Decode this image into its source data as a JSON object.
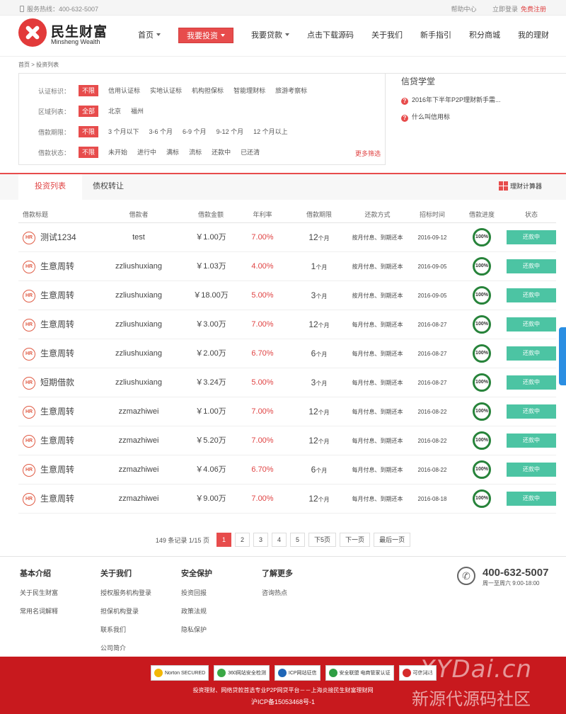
{
  "topbar": {
    "hotline": "服务热线：400-632-5007",
    "help": "帮助中心",
    "login": "立即登录",
    "register": "免费注册"
  },
  "logo": {
    "cn": "民生财富",
    "en": "Minsheng Wealth"
  },
  "nav": [
    {
      "label": "首页",
      "dropdown": true,
      "active": false
    },
    {
      "label": "我要投资",
      "dropdown": true,
      "active": true
    },
    {
      "label": "我要贷款",
      "dropdown": true,
      "active": false
    },
    {
      "label": "点击下载源码",
      "dropdown": false,
      "active": false
    },
    {
      "label": "关于我们",
      "dropdown": false,
      "active": false
    },
    {
      "label": "新手指引",
      "dropdown": false,
      "active": false
    },
    {
      "label": "积分商城",
      "dropdown": false,
      "active": false
    },
    {
      "label": "我的理财",
      "dropdown": false,
      "active": false
    }
  ],
  "breadcrumb": "首页 > 投资列表",
  "filters": [
    {
      "label": "认证标识：",
      "options": [
        "不限",
        "信用认证标",
        "实地认证标",
        "机构担保标",
        "智能理财标",
        "旅游考察标"
      ],
      "selected": 0
    },
    {
      "label": "区域列表：",
      "options": [
        "全部",
        "北京",
        "福州"
      ],
      "selected": 0
    },
    {
      "label": "借款期限：",
      "options": [
        "不限",
        "3 个月以下",
        "3-6 个月",
        "6-9 个月",
        "9-12 个月",
        "12 个月以上"
      ],
      "selected": 0
    },
    {
      "label": "借款状态：",
      "options": [
        "不限",
        "未开始",
        "进行中",
        "满标",
        "流标",
        "还款中",
        "已还清"
      ],
      "selected": 0
    }
  ],
  "more_filters": "更多筛选",
  "school": {
    "title": "信贷学堂",
    "links": [
      "2016年下半年P2P理财新手需...",
      "什么叫信用标"
    ]
  },
  "tabs": {
    "invest_list": "投资列表",
    "transfer": "债权转让",
    "calculator": "理财计算器"
  },
  "table": {
    "headers": [
      "借款标题",
      "借款者",
      "借款金额",
      "年利率",
      "借款期限",
      "还款方式",
      "招标时间",
      "借款进度",
      "状态"
    ],
    "rows": [
      {
        "badge": "HR",
        "title": "测试1234",
        "borrower": "test",
        "amount": "￥1.00万",
        "rate": "7.00%",
        "term": "12",
        "unit": "个月",
        "repay": "按月付息、到期还本",
        "date": "2016-09-12",
        "progress": "100%",
        "status": "还款中"
      },
      {
        "badge": "HR",
        "title": "生意周转",
        "borrower": "zzliushuxiang",
        "amount": "￥1.03万",
        "rate": "4.00%",
        "term": "1",
        "unit": "个月",
        "repay": "按月付息、到期还本",
        "date": "2016-09-05",
        "progress": "100%",
        "status": "还款中"
      },
      {
        "badge": "HR",
        "title": "生意周转",
        "borrower": "zzliushuxiang",
        "amount": "￥18.00万",
        "rate": "5.00%",
        "term": "3",
        "unit": "个月",
        "repay": "按月付息、到期还本",
        "date": "2016-09-05",
        "progress": "100%",
        "status": "还款中"
      },
      {
        "badge": "HR",
        "title": "生意周转",
        "borrower": "zzliushuxiang",
        "amount": "￥3.00万",
        "rate": "7.00%",
        "term": "12",
        "unit": "个月",
        "repay": "每月付息、到期还本",
        "date": "2016-08-27",
        "progress": "100%",
        "status": "还款中"
      },
      {
        "badge": "HR",
        "title": "生意周转",
        "borrower": "zzliushuxiang",
        "amount": "￥2.00万",
        "rate": "6.70%",
        "term": "6",
        "unit": "个月",
        "repay": "每月付息、到期还本",
        "date": "2016-08-27",
        "progress": "100%",
        "status": "还款中"
      },
      {
        "badge": "HR",
        "title": "短期借款",
        "borrower": "zzliushuxiang",
        "amount": "￥3.24万",
        "rate": "5.00%",
        "term": "3",
        "unit": "个月",
        "repay": "每月付息、到期还本",
        "date": "2016-08-27",
        "progress": "100%",
        "status": "还款中"
      },
      {
        "badge": "HR",
        "title": "生意周转",
        "borrower": "zzmazhiwei",
        "amount": "￥1.00万",
        "rate": "7.00%",
        "term": "12",
        "unit": "个月",
        "repay": "每月付息、到期还本",
        "date": "2016-08-22",
        "progress": "100%",
        "status": "还款中"
      },
      {
        "badge": "HR",
        "title": "生意周转",
        "borrower": "zzmazhiwei",
        "amount": "￥5.20万",
        "rate": "7.00%",
        "term": "12",
        "unit": "个月",
        "repay": "每月付息、到期还本",
        "date": "2016-08-22",
        "progress": "100%",
        "status": "还款中"
      },
      {
        "badge": "HR",
        "title": "生意周转",
        "borrower": "zzmazhiwei",
        "amount": "￥4.06万",
        "rate": "6.70%",
        "term": "6",
        "unit": "个月",
        "repay": "每月付息、到期还本",
        "date": "2016-08-22",
        "progress": "100%",
        "status": "还款中"
      },
      {
        "badge": "HR",
        "title": "生意周转",
        "borrower": "zzmazhiwei",
        "amount": "￥9.00万",
        "rate": "7.00%",
        "term": "12",
        "unit": "个月",
        "repay": "每月付息、到期还本",
        "date": "2016-08-18",
        "progress": "100%",
        "status": "还款中"
      }
    ]
  },
  "pager": {
    "info": "149 条记录 1/15 页",
    "pages": [
      "1",
      "2",
      "3",
      "4",
      "5"
    ],
    "current": "1",
    "next5": "下5页",
    "next": "下一页",
    "last": "最后一页"
  },
  "footer": {
    "columns": [
      {
        "title": "基本介绍",
        "links": [
          "关于民生财富",
          "常用名词解释"
        ]
      },
      {
        "title": "关于我们",
        "links": [
          "授权服务机构登录",
          "担保机构登录",
          "联系我们",
          "公司简介"
        ]
      },
      {
        "title": "安全保护",
        "links": [
          "投资回报",
          "政策法规",
          "隐私保护"
        ]
      },
      {
        "title": "了解更多",
        "links": [
          "咨询热点"
        ]
      }
    ],
    "phone": "400-632-5007",
    "hours": "周一至周六 9:00-18:00"
  },
  "bottom": {
    "badges": [
      "Norton SECURED",
      "360网站安全检测",
      "ICP网站征信",
      "安全联盟 电商管家认证",
      "可信网站"
    ],
    "line1": "投资理财、网络贷款首选专业P2P网贷平台－－上海炎接民生财富理财网",
    "icp": "沪ICP备15053468号-1",
    "watermark": "XYDai.cn",
    "watermark_cn": "新源代源码社区"
  }
}
